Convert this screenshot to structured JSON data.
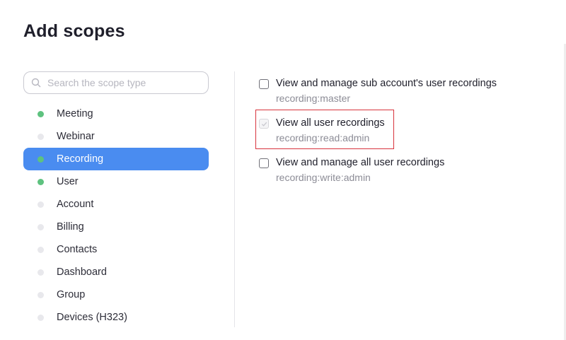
{
  "page": {
    "title": "Add scopes"
  },
  "search": {
    "placeholder": "Search the scope type",
    "icon": "search-icon"
  },
  "sidebar": {
    "items": [
      {
        "label": "Meeting",
        "enabled": true,
        "active": false
      },
      {
        "label": "Webinar",
        "enabled": false,
        "active": false
      },
      {
        "label": "Recording",
        "enabled": true,
        "active": true
      },
      {
        "label": "User",
        "enabled": true,
        "active": false
      },
      {
        "label": "Account",
        "enabled": false,
        "active": false
      },
      {
        "label": "Billing",
        "enabled": false,
        "active": false
      },
      {
        "label": "Contacts",
        "enabled": false,
        "active": false
      },
      {
        "label": "Dashboard",
        "enabled": false,
        "active": false
      },
      {
        "label": "Group",
        "enabled": false,
        "active": false
      },
      {
        "label": "Devices (H323)",
        "enabled": false,
        "active": false
      }
    ]
  },
  "scopes": [
    {
      "title": "View and manage sub account's user recordings",
      "code": "recording:master",
      "checked": false,
      "highlighted": false
    },
    {
      "title": "View all user recordings",
      "code": "recording:read:admin",
      "checked": true,
      "highlighted": true
    },
    {
      "title": "View and manage all user recordings",
      "code": "recording:write:admin",
      "checked": false,
      "highlighted": false
    }
  ],
  "colors": {
    "accent": "#4a8cf0",
    "enabled_dot": "#5ec27f",
    "disabled_dot": "#e8e8ec",
    "highlight_border": "#d8333c"
  }
}
